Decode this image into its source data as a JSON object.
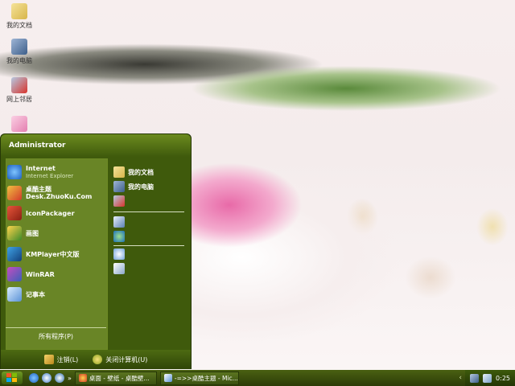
{
  "desktop": {
    "icons": [
      {
        "label": "我的文档"
      },
      {
        "label": "我的电脑"
      },
      {
        "label": "网上邻居"
      },
      {
        "label": "回收站"
      }
    ]
  },
  "start_menu": {
    "user": "Administrator",
    "left_items": [
      {
        "label": "Internet",
        "sub": "Internet Explorer"
      },
      {
        "label": "桌酷主题",
        "sub": "Desk.ZhuoKu.Com"
      },
      {
        "label": "IconPackager",
        "sub": ""
      },
      {
        "label": "画图",
        "sub": ""
      },
      {
        "label": "KMPlayer中文版",
        "sub": ""
      },
      {
        "label": "WinRAR",
        "sub": ""
      },
      {
        "label": "记事本",
        "sub": ""
      }
    ],
    "all_programs": "所有程序(P)",
    "right_items": [
      {
        "label": "我的文档"
      },
      {
        "label": "我的电脑"
      },
      {
        "label": ""
      },
      {
        "label": ""
      },
      {
        "label": ""
      },
      {
        "label": ""
      },
      {
        "label": ""
      }
    ],
    "logoff": "注销(L)",
    "shutdown": "关闭计算机(U)"
  },
  "taskbar": {
    "tasks": [
      {
        "label": "桌面 - 壁纸 - 桌酷壁..."
      },
      {
        "label": "-=>>桌酷主题 - Mic..."
      }
    ],
    "clock": "0:25"
  },
  "colors": {
    "theme_green": "#3f5a0c",
    "taskbar": "#2c3c07"
  }
}
